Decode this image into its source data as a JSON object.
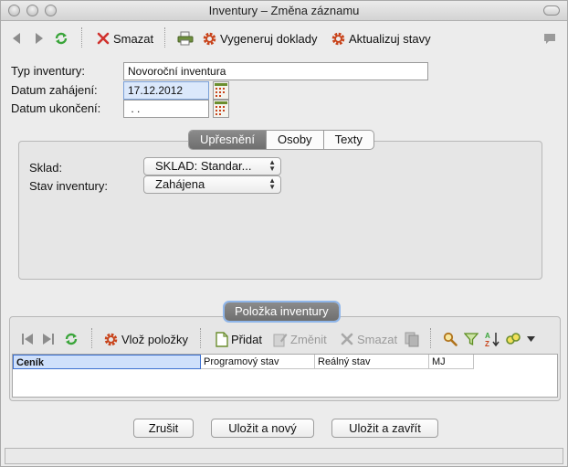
{
  "window": {
    "title": "Inventury – Změna záznamu"
  },
  "toolbar": {
    "delete_label": "Smazat",
    "generate_label": "Vygeneruj doklady",
    "update_label": "Aktualizuj stavy"
  },
  "form": {
    "type_label": "Typ inventury:",
    "type_value": "Novoroční inventura",
    "start_label": "Datum zahájení:",
    "start_value": "17.12.2012",
    "end_label": "Datum ukončení:",
    "end_value": " . ."
  },
  "tabs": [
    {
      "label": "Upřesnění",
      "active": true
    },
    {
      "label": "Osoby",
      "active": false
    },
    {
      "label": "Texty",
      "active": false
    }
  ],
  "details": {
    "warehouse_label": "Sklad:",
    "warehouse_value": "SKLAD: Standar...",
    "status_label": "Stav inventury:",
    "status_value": "Zahájena"
  },
  "items": {
    "title": "Položka inventury",
    "insert_label": "Vlož položky",
    "add_label": "Přidat",
    "edit_label": "Změnit",
    "delete_label": "Smazat",
    "columns": [
      "Ceník",
      "Programový stav",
      "Reálný stav",
      "MJ"
    ]
  },
  "buttons": {
    "cancel": "Zrušit",
    "save_new": "Uložit a nový",
    "save_close": "Uložit a zavřít"
  },
  "colors": {
    "accent": "#3b6fd0",
    "gear_icon": "#c8431a",
    "delete_icon": "#d0312d",
    "refresh_icon": "#3aa53a"
  }
}
